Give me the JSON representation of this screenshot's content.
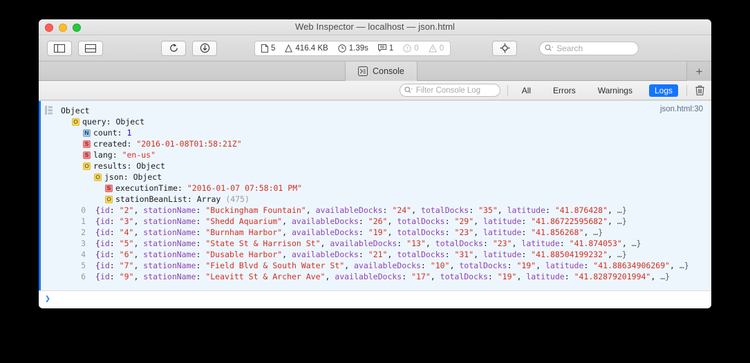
{
  "window": {
    "title": "Web Inspector — localhost — json.html",
    "traffic_lights": [
      "close",
      "minimize",
      "zoom"
    ]
  },
  "toolbar": {
    "buttons": [
      {
        "name": "toggle-navigation-sidebar",
        "icon": "sidebar-left-icon"
      },
      {
        "name": "toggle-split-console",
        "icon": "split-horizontal-icon"
      },
      {
        "name": "reload-button",
        "icon": "reload-icon"
      },
      {
        "name": "download-web-archive",
        "icon": "download-icon"
      }
    ],
    "stats": [
      {
        "icon": "document-icon",
        "value": "5",
        "dim": false
      },
      {
        "icon": "weight-icon",
        "value": "416.4 KB",
        "dim": false
      },
      {
        "icon": "clock-icon",
        "value": "1.39s",
        "dim": false
      },
      {
        "icon": "message-icon",
        "value": "1",
        "dim": false
      },
      {
        "icon": "error-icon",
        "value": "0",
        "dim": true
      },
      {
        "icon": "warning-icon",
        "value": "0",
        "dim": true
      }
    ],
    "inspect_button": {
      "name": "element-selector-button",
      "icon": "crosshair-icon"
    },
    "search": {
      "placeholder": "Search",
      "icon": "search-icon",
      "value": ""
    }
  },
  "tabbar": {
    "tab_label": "Console",
    "tab_icon": "console-prompt-icon",
    "add_tab_label": "+"
  },
  "filterbar": {
    "filter_placeholder": "Filter Console Log",
    "filter_value": "",
    "scopes": [
      {
        "label": "All",
        "active": false
      },
      {
        "label": "Errors",
        "active": false
      },
      {
        "label": "Warnings",
        "active": false
      },
      {
        "label": "Logs",
        "active": true
      }
    ],
    "clear_icon": "trash-icon",
    "active_color": "#1375ff"
  },
  "console": {
    "entry_source": "json.html:30",
    "root_label": "Object",
    "tree": [
      {
        "indent": 1,
        "badge": "O",
        "key": "query",
        "sep": ": ",
        "type": "Object"
      },
      {
        "indent": 2,
        "badge": "N",
        "key": "count",
        "sep": ": ",
        "num": "1"
      },
      {
        "indent": 2,
        "badge": "S",
        "key": "created",
        "sep": ": ",
        "str": "\"2016-01-08T01:58:21Z\""
      },
      {
        "indent": 2,
        "badge": "S",
        "key": "lang",
        "sep": ": ",
        "str": "\"en-us\""
      },
      {
        "indent": 2,
        "badge": "O",
        "key": "results",
        "sep": ": ",
        "type": "Object"
      },
      {
        "indent": 3,
        "badge": "O",
        "key": "json",
        "sep": ": ",
        "type": "Object"
      },
      {
        "indent": 4,
        "badge": "S",
        "key": "executionTime",
        "sep": ": ",
        "str": "\"2016-01-07 07:58:01 PM\""
      },
      {
        "indent": 4,
        "badge": "O",
        "key": "stationBeanList",
        "sep": ": ",
        "type": "Array",
        "count": "(475)"
      }
    ],
    "array_rows": [
      {
        "index": "0",
        "id": "\"2\"",
        "stationName": "\"Buckingham Fountain\"",
        "availableDocks": "\"24\"",
        "totalDocks": "\"35\"",
        "latitude": "\"41.876428\""
      },
      {
        "index": "1",
        "id": "\"3\"",
        "stationName": "\"Shedd Aquarium\"",
        "availableDocks": "\"26\"",
        "totalDocks": "\"29\"",
        "latitude": "\"41.86722595682\""
      },
      {
        "index": "2",
        "id": "\"4\"",
        "stationName": "\"Burnham Harbor\"",
        "availableDocks": "\"19\"",
        "totalDocks": "\"23\"",
        "latitude": "\"41.856268\""
      },
      {
        "index": "3",
        "id": "\"5\"",
        "stationName": "\"State St & Harrison St\"",
        "availableDocks": "\"13\"",
        "totalDocks": "\"23\"",
        "latitude": "\"41.874053\""
      },
      {
        "index": "4",
        "id": "\"6\"",
        "stationName": "\"Dusable Harbor\"",
        "availableDocks": "\"21\"",
        "totalDocks": "\"31\"",
        "latitude": "\"41.88504199232\""
      },
      {
        "index": "5",
        "id": "\"7\"",
        "stationName": "\"Field Blvd & South Water St\"",
        "availableDocks": "\"10\"",
        "totalDocks": "\"19\"",
        "latitude": "\"41.88634906269\""
      },
      {
        "index": "6",
        "id": "\"9\"",
        "stationName": "\"Leavitt St & Archer Ave\"",
        "availableDocks": "\"17\"",
        "totalDocks": "\"19\"",
        "latitude": "\"41.82879201994\""
      }
    ],
    "array_keys": {
      "id": "id",
      "stationName": "stationName",
      "availableDocks": "availableDocks",
      "totalDocks": "totalDocks",
      "latitude": "latitude"
    },
    "ellipsis": "…}"
  },
  "prompt": {
    "chevron": "❯",
    "value": ""
  }
}
